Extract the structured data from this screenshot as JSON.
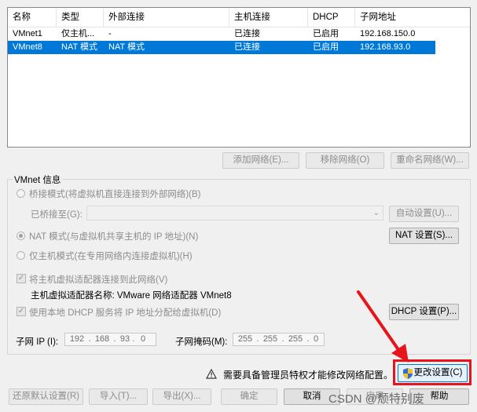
{
  "table": {
    "headers": [
      "名称",
      "类型",
      "外部连接",
      "主机连接",
      "DHCP",
      "子网地址"
    ],
    "rows": [
      {
        "name": "VMnet1",
        "type": "仅主机...",
        "external": "-",
        "host": "已连接",
        "dhcp": "已启用",
        "subnet": "192.168.150.0",
        "selected": false
      },
      {
        "name": "VMnet8",
        "type": "NAT 模式",
        "external": "NAT 模式",
        "host": "已连接",
        "dhcp": "已启用",
        "subnet": "192.168.93.0",
        "selected": true
      }
    ]
  },
  "table_buttons": {
    "add": "添加网络(E)...",
    "remove": "移除网络(O)",
    "rename": "重命名网络(W)..."
  },
  "vmnet_info": {
    "title": "VMnet 信息",
    "bridge_mode": "桥接模式(将虚拟机直接连接到外部网络)(B)",
    "bridged_to_label": "已桥接至(G):",
    "bridged_to_value": "",
    "auto_settings": "自动设置(U)...",
    "nat_mode": "NAT 模式(与虚拟机共享主机的 IP 地址)(N)",
    "nat_settings": "NAT 设置(S)...",
    "host_only_mode": "仅主机模式(在专用网络内连接虚拟机)(H)",
    "connect_adapter": "将主机虚拟适配器连接到此网络(V)",
    "adapter_name": "主机虚拟适配器名称: VMware 网络适配器 VMnet8",
    "use_dhcp": "使用本地 DHCP 服务将 IP 地址分配给虚拟机(D)",
    "dhcp_settings": "DHCP 设置(P)...",
    "subnet_ip_label": "子网 IP (I):",
    "subnet_ip": [
      "192",
      "168",
      "93",
      "0"
    ],
    "subnet_mask_label": "子网掩码(M):",
    "subnet_mask": [
      "255",
      "255",
      "255",
      "0"
    ]
  },
  "admin_notice": "需要具备管理员特权才能修改网络配置。",
  "icons": {
    "warning": "warning-icon",
    "shield": "uac-shield-icon"
  },
  "accent_color": "#0078d7",
  "highlight_color": "#e8141b",
  "footer": {
    "change_settings": "更改设置(C)",
    "restore_defaults": "还原默认设置(R)",
    "import": "导入(T)...",
    "export": "导出(X)...",
    "ok": "确定",
    "cancel": "取消",
    "apply": "应用",
    "help": "帮助"
  },
  "watermark": "CSDN @颓特别废"
}
